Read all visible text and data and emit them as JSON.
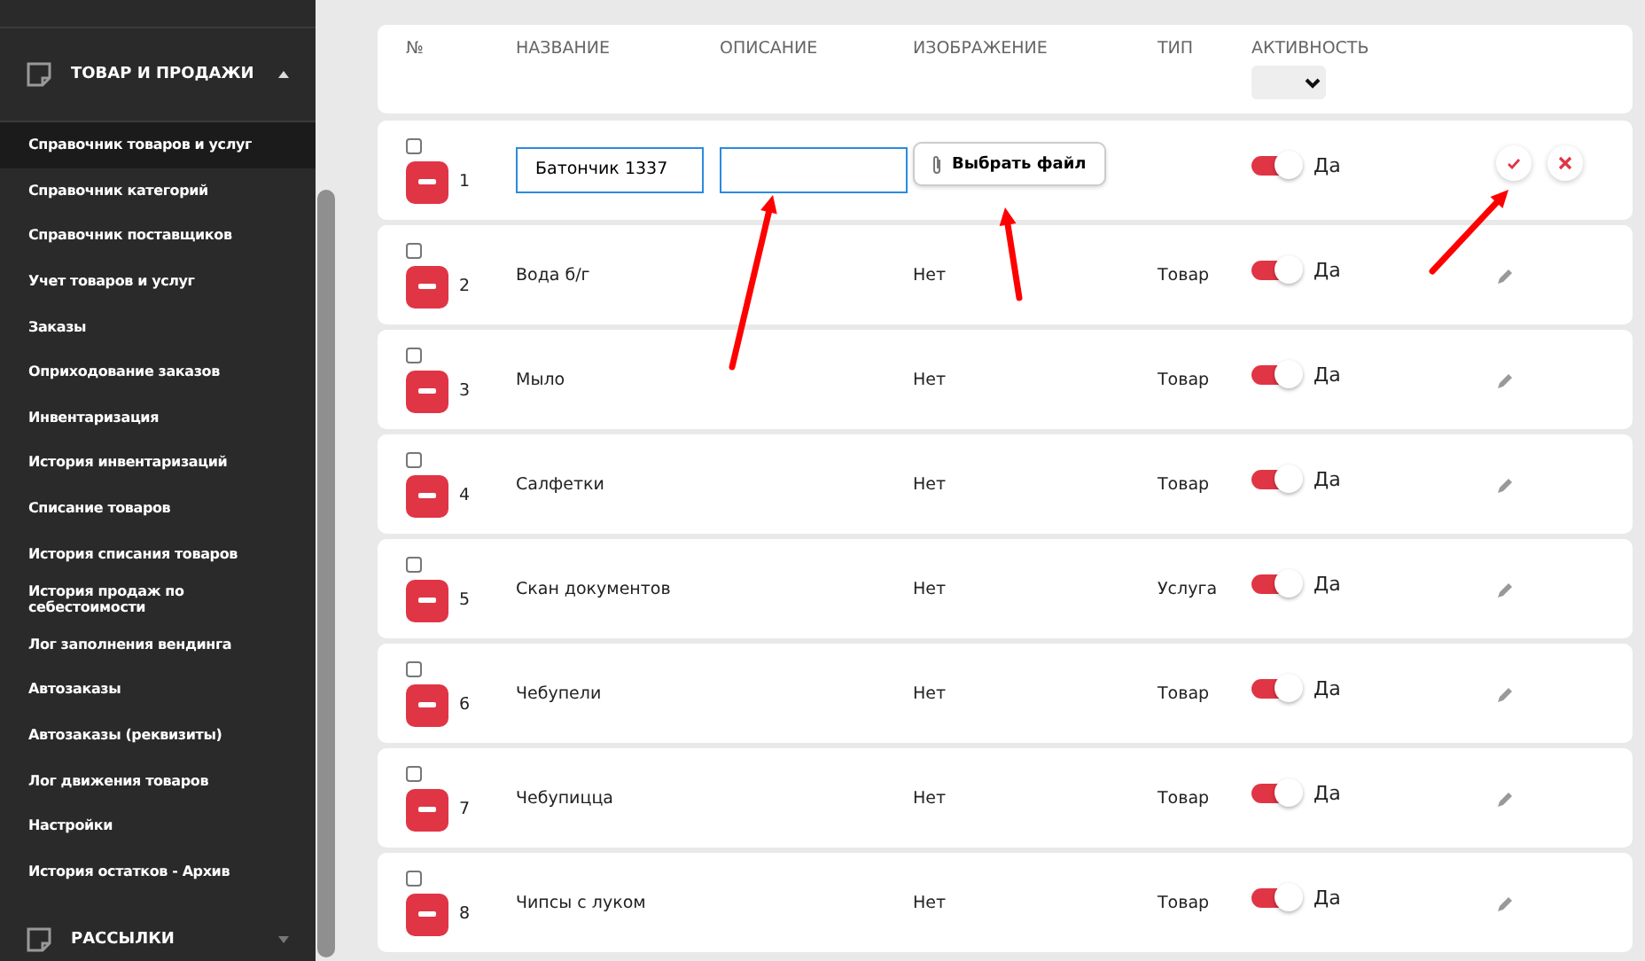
{
  "sidebar": {
    "sections": [
      {
        "title": "ТОВАР И ПРОДАЖИ",
        "expanded": true,
        "items": [
          {
            "label": "Справочник товаров и услуг",
            "selected": true
          },
          {
            "label": "Справочник категорий",
            "selected": false
          },
          {
            "label": "Справочник поставщиков",
            "selected": false
          },
          {
            "label": "Учет товаров и услуг",
            "selected": false
          },
          {
            "label": "Заказы",
            "selected": false
          },
          {
            "label": "Оприходование заказов",
            "selected": false
          },
          {
            "label": "Инвентаризация",
            "selected": false
          },
          {
            "label": "История инвентаризаций",
            "selected": false
          },
          {
            "label": "Списание товаров",
            "selected": false
          },
          {
            "label": "История списания товаров",
            "selected": false
          },
          {
            "label": "История продаж по себестоимости",
            "selected": false
          },
          {
            "label": "Лог заполнения вендинга",
            "selected": false
          },
          {
            "label": "Автозаказы",
            "selected": false
          },
          {
            "label": "Автозаказы (реквизиты)",
            "selected": false
          },
          {
            "label": "Лог движения товаров",
            "selected": false
          },
          {
            "label": "Настройки",
            "selected": false
          },
          {
            "label": "История остатков - Архив",
            "selected": false
          }
        ]
      },
      {
        "title": "РАССЫЛКИ",
        "expanded": false
      }
    ]
  },
  "table": {
    "columns": [
      "№",
      "НАЗВАНИЕ",
      "ОПИСАНИЕ",
      "ИЗОБРАЖЕНИЕ",
      "ТИП",
      "АКТИВНОСТЬ"
    ],
    "rows": [
      {
        "kind": "edit",
        "checked": false,
        "number": "1",
        "name": "Батончик 1337",
        "description": "",
        "image": "Выбрать файл",
        "type": "",
        "active": true,
        "active_label": "Да"
      },
      {
        "kind": "view",
        "checked": false,
        "number": "2",
        "name": "Вода б/г",
        "description": "",
        "image": "Нет",
        "type": "Товар",
        "active": true,
        "active_label": "Да"
      },
      {
        "kind": "view",
        "checked": false,
        "number": "3",
        "name": "Мыло",
        "description": "",
        "image": "Нет",
        "type": "Товар",
        "active": true,
        "active_label": "Да"
      },
      {
        "kind": "view",
        "checked": false,
        "number": "4",
        "name": "Салфетки",
        "description": "",
        "image": "Нет",
        "type": "Товар",
        "active": true,
        "active_label": "Да"
      },
      {
        "kind": "view",
        "checked": false,
        "number": "5",
        "name": "Скан документов",
        "description": "",
        "image": "Нет",
        "type": "Услуга",
        "active": true,
        "active_label": "Да"
      },
      {
        "kind": "view",
        "checked": false,
        "number": "6",
        "name": "Чебупели",
        "description": "",
        "image": "Нет",
        "type": "Товар",
        "active": true,
        "active_label": "Да"
      },
      {
        "kind": "view",
        "checked": false,
        "number": "7",
        "name": "Чебупицца",
        "description": "",
        "image": "Нет",
        "type": "Товар",
        "active": true,
        "active_label": "Да"
      },
      {
        "kind": "view",
        "checked": false,
        "number": "8",
        "name": "Чипсы с луком",
        "description": "",
        "image": "Нет",
        "type": "Товар",
        "active": true,
        "active_label": "Да"
      }
    ]
  }
}
